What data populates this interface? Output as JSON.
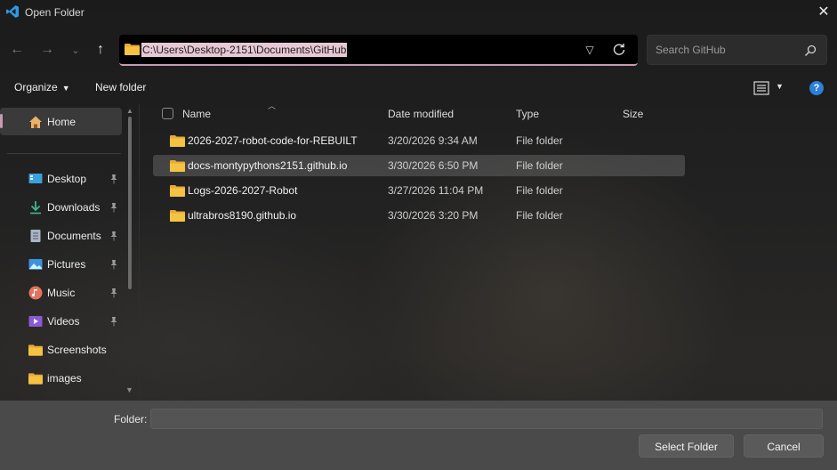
{
  "window": {
    "title": "Open Folder"
  },
  "address": {
    "path": "C:\\Users\\Desktop-2151\\Documents\\GitHub"
  },
  "search": {
    "placeholder": "Search GitHub"
  },
  "toolbar": {
    "organize": "Organize",
    "new_folder": "New folder"
  },
  "sidebar": {
    "home": "Home",
    "items": [
      {
        "label": "Desktop",
        "icon": "desktop-icon",
        "pinned": true
      },
      {
        "label": "Downloads",
        "icon": "download-icon",
        "pinned": true
      },
      {
        "label": "Documents",
        "icon": "document-icon",
        "pinned": true
      },
      {
        "label": "Pictures",
        "icon": "picture-icon",
        "pinned": true
      },
      {
        "label": "Music",
        "icon": "music-icon",
        "pinned": true
      },
      {
        "label": "Videos",
        "icon": "video-icon",
        "pinned": true
      },
      {
        "label": "Screenshots",
        "icon": "folder-icon",
        "pinned": false
      },
      {
        "label": "images",
        "icon": "folder-icon",
        "pinned": false
      }
    ]
  },
  "columns": {
    "name": "Name",
    "date": "Date modified",
    "type": "Type",
    "size": "Size"
  },
  "files": [
    {
      "name": "2026-2027-robot-code-for-REBUILT",
      "date": "3/20/2026 9:34 AM",
      "type": "File folder"
    },
    {
      "name": "docs-montypythons2151.github.io",
      "date": "3/30/2026 6:50 PM",
      "type": "File folder",
      "selected": true
    },
    {
      "name": "Logs-2026-2027-Robot",
      "date": "3/27/2026 11:04 PM",
      "type": "File folder"
    },
    {
      "name": "ultrabros8190.github.io",
      "date": "3/30/2026 3:20 PM",
      "type": "File folder"
    }
  ],
  "footer": {
    "folder_label": "Folder:",
    "folder_value": "",
    "select_button": "Select Folder",
    "cancel_button": "Cancel"
  },
  "colors": {
    "accent": "#c79ab0",
    "folder": "#f5c242",
    "help": "#2d7fd8",
    "selection_text_bg": "#e7c8d4"
  }
}
